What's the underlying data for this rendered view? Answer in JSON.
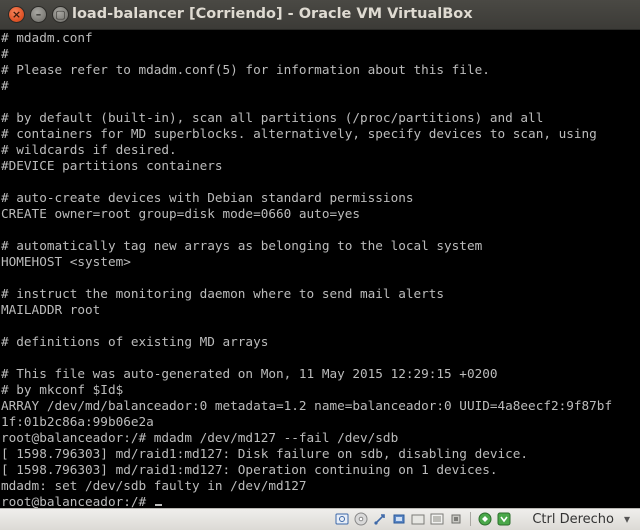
{
  "window": {
    "title": "load-balancer [Corriendo] - Oracle VM VirtualBox",
    "close_glyph": "×",
    "min_glyph": "–",
    "max_glyph": "▢"
  },
  "console": {
    "lines": [
      "# mdadm.conf",
      "#",
      "# Please refer to mdadm.conf(5) for information about this file.",
      "#",
      "",
      "# by default (built-in), scan all partitions (/proc/partitions) and all",
      "# containers for MD superblocks. alternatively, specify devices to scan, using",
      "# wildcards if desired.",
      "#DEVICE partitions containers",
      "",
      "# auto-create devices with Debian standard permissions",
      "CREATE owner=root group=disk mode=0660 auto=yes",
      "",
      "# automatically tag new arrays as belonging to the local system",
      "HOMEHOST <system>",
      "",
      "# instruct the monitoring daemon where to send mail alerts",
      "MAILADDR root",
      "",
      "# definitions of existing MD arrays",
      "",
      "# This file was auto-generated on Mon, 11 May 2015 12:29:15 +0200",
      "# by mkconf $Id$",
      "ARRAY /dev/md/balanceador:0 metadata=1.2 name=balanceador:0 UUID=4a8eecf2:9f87bf",
      "1f:01b2c86a:99b06e2a",
      "root@balanceador:/# mdadm /dev/md127 --fail /dev/sdb",
      "[ 1598.796303] md/raid1:md127: Disk failure on sdb, disabling device.",
      "[ 1598.796303] md/raid1:md127: Operation continuing on 1 devices.",
      "mdadm: set /dev/sdb faulty in /dev/md127",
      "root@balanceador:/# "
    ]
  },
  "statusbar": {
    "host_key_label": "Ctrl Derecho",
    "host_key_arrow": "▾",
    "icons": [
      "hard-disk-icon",
      "optical-disc-icon",
      "usb-icon",
      "shared-folder-icon",
      "display-icon",
      "video-capture-icon",
      "cpu-icon",
      "network-icon",
      "keyboard-capture-icon"
    ]
  },
  "colors": {
    "terminal_fg": "#bcbcbc",
    "terminal_bg": "#000000",
    "titlebar": "#3c3b37",
    "close_button": "#e1562a"
  }
}
